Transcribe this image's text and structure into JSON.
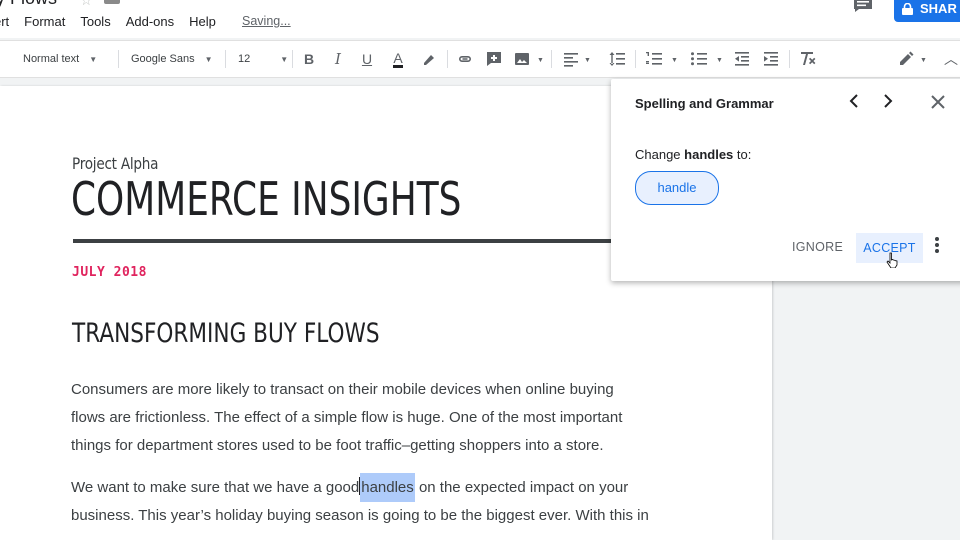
{
  "window": {
    "title_partial": "y Flows",
    "saving": "Saving..."
  },
  "menu": [
    "ert",
    "Format",
    "Tools",
    "Add-ons",
    "Help"
  ],
  "share_label": "SHAR",
  "toolbar": {
    "style": "Normal text",
    "font": "Google Sans",
    "size": "12"
  },
  "icons": [
    "bold-icon",
    "italic-icon",
    "underline-icon",
    "text-color-icon",
    "highlight-icon",
    "link-icon",
    "comment-add-icon",
    "image-icon",
    "align-left-icon",
    "line-spacing-icon",
    "numbered-list-icon",
    "bulleted-list-icon",
    "decrease-indent-icon",
    "increase-indent-icon",
    "clear-format-icon",
    "edit-mode-icon",
    "collapse-icon"
  ],
  "document": {
    "project": "Project Alpha",
    "title": "COMMERCE INSIGHTS",
    "date": "JULY 2018",
    "heading": "TRANSFORMING BUY FLOWS",
    "p1_line1": "Consumers are more likely to transact on their mobile devices when online buying",
    "p1_line2": "flows are frictionless. The effect of a simple flow is huge. One of the most important",
    "p1_line3": "things for department stores used to be foot traffic–getting shoppers into a store.",
    "p2_line1_a": "We want to make sure that we have a good",
    "p2_line1_word": "handles",
    "p2_line1_b": " on the expected impact on your",
    "p2_line2": "business. This year’s holiday buying season is going to be the biggest ever. With this in"
  },
  "spelling_panel": {
    "title": "Spelling and Grammar",
    "change_prefix": "Change ",
    "change_word": "handles",
    "change_suffix": " to:",
    "suggestion": "handle",
    "ignore": "IGNORE",
    "accept": "ACCEPT"
  },
  "colors": {
    "accent": "#1a73e8",
    "date": "#e0245e",
    "highlight": "#aecbfa"
  }
}
